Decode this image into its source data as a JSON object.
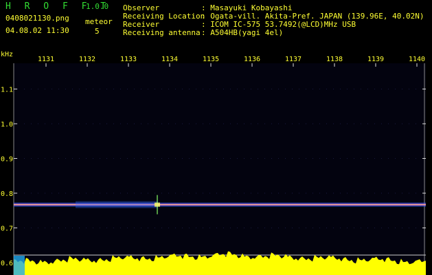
{
  "header": {
    "app_name": "H R O F F T",
    "version": "1.0.0",
    "filename": "0408021130.png",
    "datetime": "04.08.02 11:30",
    "meteor_label": "meteor",
    "meteor_count": "5"
  },
  "info": [
    {
      "label": "Observer",
      "value": ": Masayuki Kobayashi"
    },
    {
      "label": "Receiving Location",
      "value": ": Ogata-vill. Akita-Pref. JAPAN (139.96E, 40.02N)"
    },
    {
      "label": "Receiver",
      "value": ": ICOM IC-575 53.7492(@LCD)MHz USB"
    },
    {
      "label": "Receiving antenna",
      "value": ": A504HB(yagi 4el)"
    }
  ],
  "chart_data": {
    "type": "heatmap",
    "ylabel": "kHz",
    "x_ticks": [
      "1131",
      "1132",
      "1133",
      "1134",
      "1135",
      "1136",
      "1137",
      "1138",
      "1139",
      "1140"
    ],
    "y_ticks": [
      "1.1",
      "1.0",
      "0.9",
      "0.8",
      "0.7",
      "0.6"
    ],
    "y_values": [
      1.1,
      1.0,
      0.9,
      0.8,
      0.7,
      0.6
    ],
    "ylim": [
      0.6,
      1.15
    ],
    "carrier_khz": 0.767,
    "meteor_echo": {
      "x_tick": "1133",
      "frequency_khz": 0.767
    }
  },
  "colors": {
    "text": "#ffff33",
    "title": "#33dd33",
    "background": "#000000",
    "trace_core": "#dd66cc",
    "trace_edge": "#3366ff",
    "trace_hot": "#ffee44",
    "spectrum": "#ffff00"
  }
}
